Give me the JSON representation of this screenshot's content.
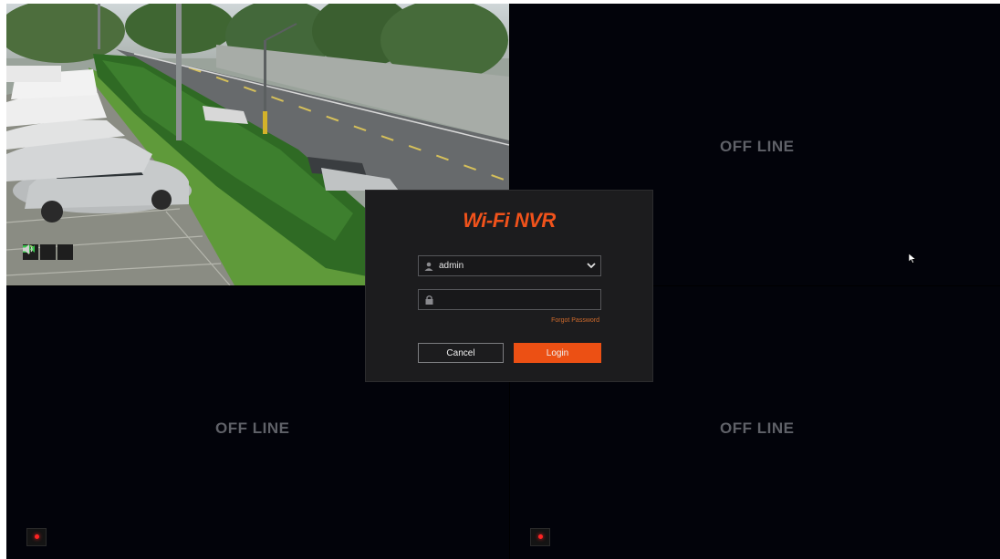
{
  "tiles": [
    {
      "id": 1,
      "status": "live"
    },
    {
      "id": 2,
      "status": "offline",
      "label": "OFF LINE"
    },
    {
      "id": 3,
      "status": "offline",
      "label": "OFF LINE"
    },
    {
      "id": 4,
      "status": "offline",
      "label": "OFF LINE"
    }
  ],
  "camera1": {
    "status_icons": [
      "wifi-icon",
      "video-camera-icon",
      "speaker-icon"
    ],
    "icon_colors": {
      "wifi": "#8fd16a",
      "camera": "#37c24a",
      "speaker": "#d0d0d0"
    }
  },
  "login": {
    "brand": "Wi-Fi NVR",
    "username": {
      "value": "admin",
      "icon": "user-icon"
    },
    "password": {
      "value": "",
      "icon": "lock-icon"
    },
    "forgot_password": "Forgot Password",
    "cancel_label": "Cancel",
    "login_label": "Login"
  },
  "colors": {
    "accent": "#ec5014",
    "brand": "#f0521b",
    "record_indicator": "#ff2323"
  }
}
